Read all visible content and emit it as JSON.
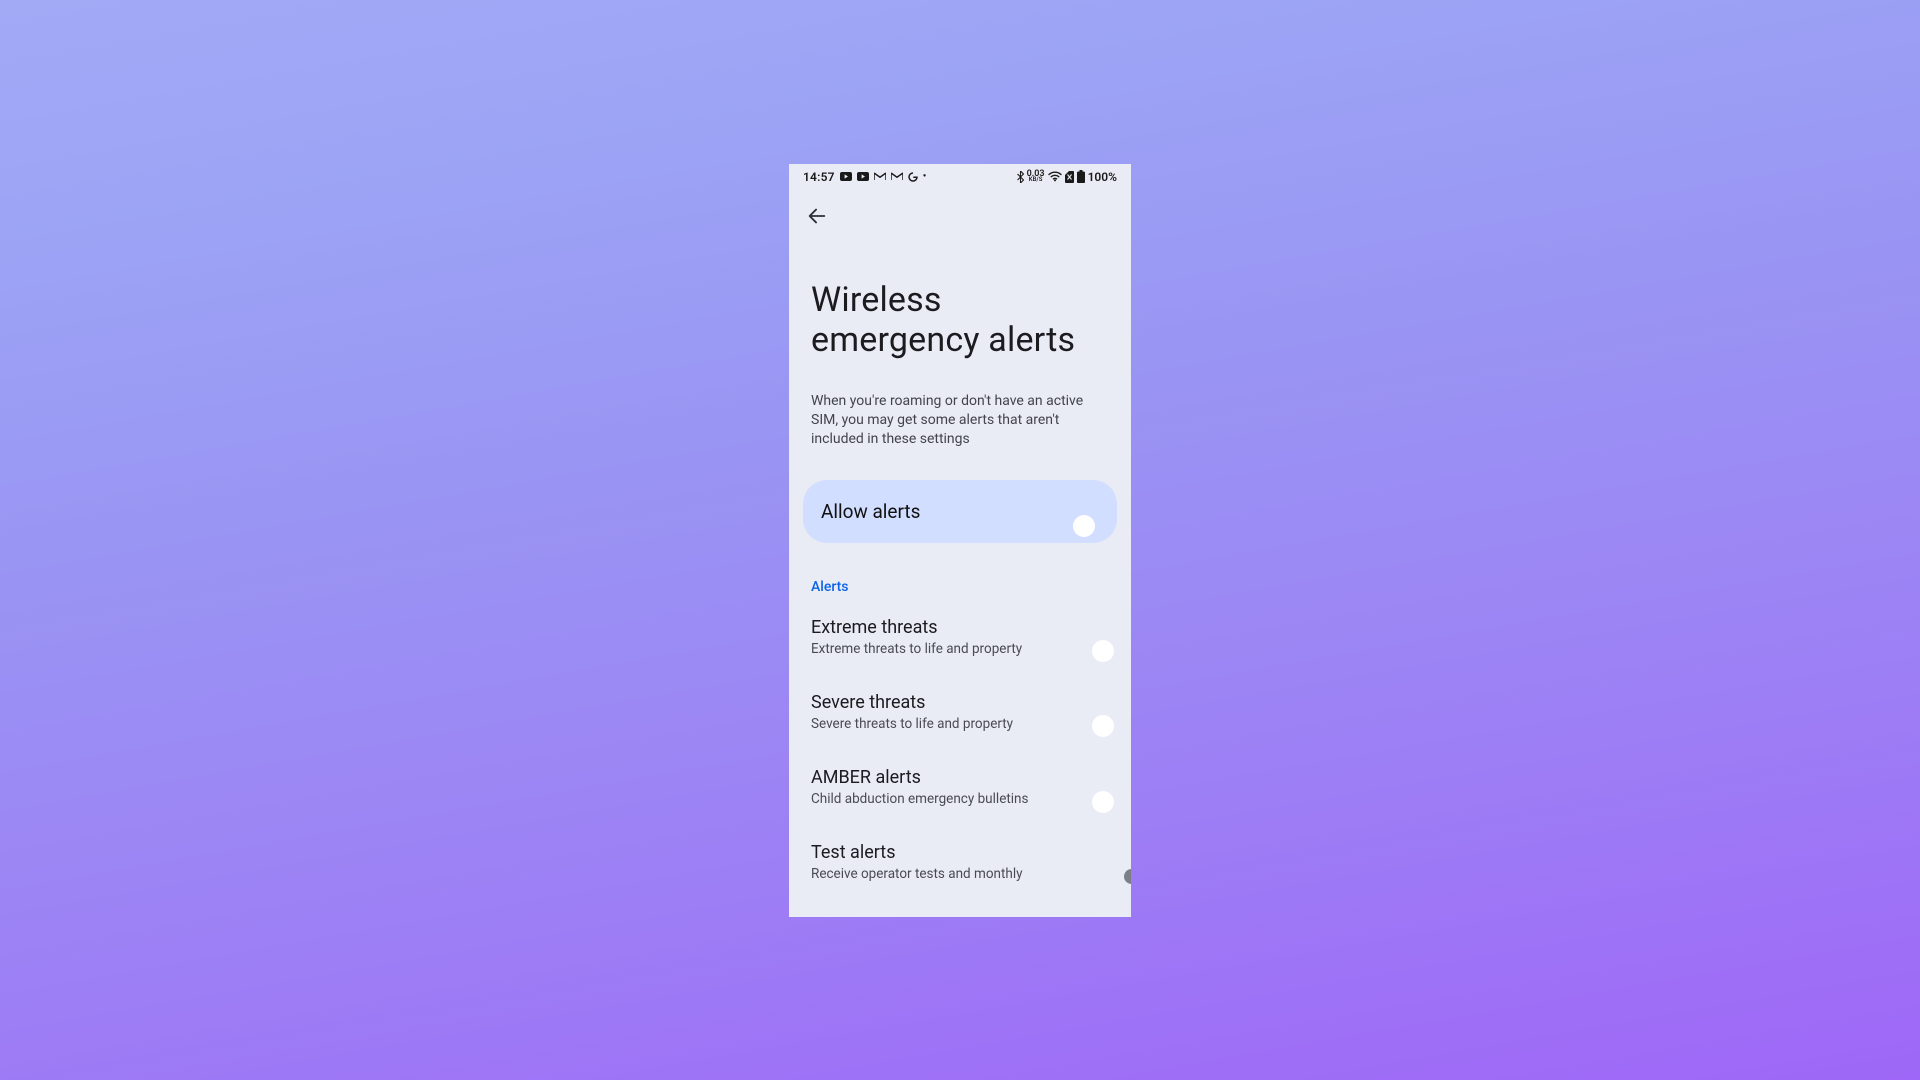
{
  "statusbar": {
    "time": "14:57",
    "net": {
      "speed_top": "0.03",
      "speed_bottom": "KB/S"
    },
    "battery_text": "100%"
  },
  "page": {
    "title": "Wireless emergency alerts",
    "info": "When you're roaming or don't have an active SIM, you may get some alerts that aren't included in these settings"
  },
  "master": {
    "label": "Allow alerts",
    "value": true
  },
  "section_header": "Alerts",
  "rows": [
    {
      "id": "extreme",
      "title": "Extreme threats",
      "sub": "Extreme threats to life and property",
      "value": true
    },
    {
      "id": "severe",
      "title": "Severe threats",
      "sub": "Severe threats to life and property",
      "value": true
    },
    {
      "id": "amber",
      "title": "AMBER alerts",
      "sub": "Child abduction emergency bulletins",
      "value": true
    },
    {
      "id": "test",
      "title": "Test alerts",
      "sub": "Receive operator tests and monthly",
      "value": false
    }
  ]
}
